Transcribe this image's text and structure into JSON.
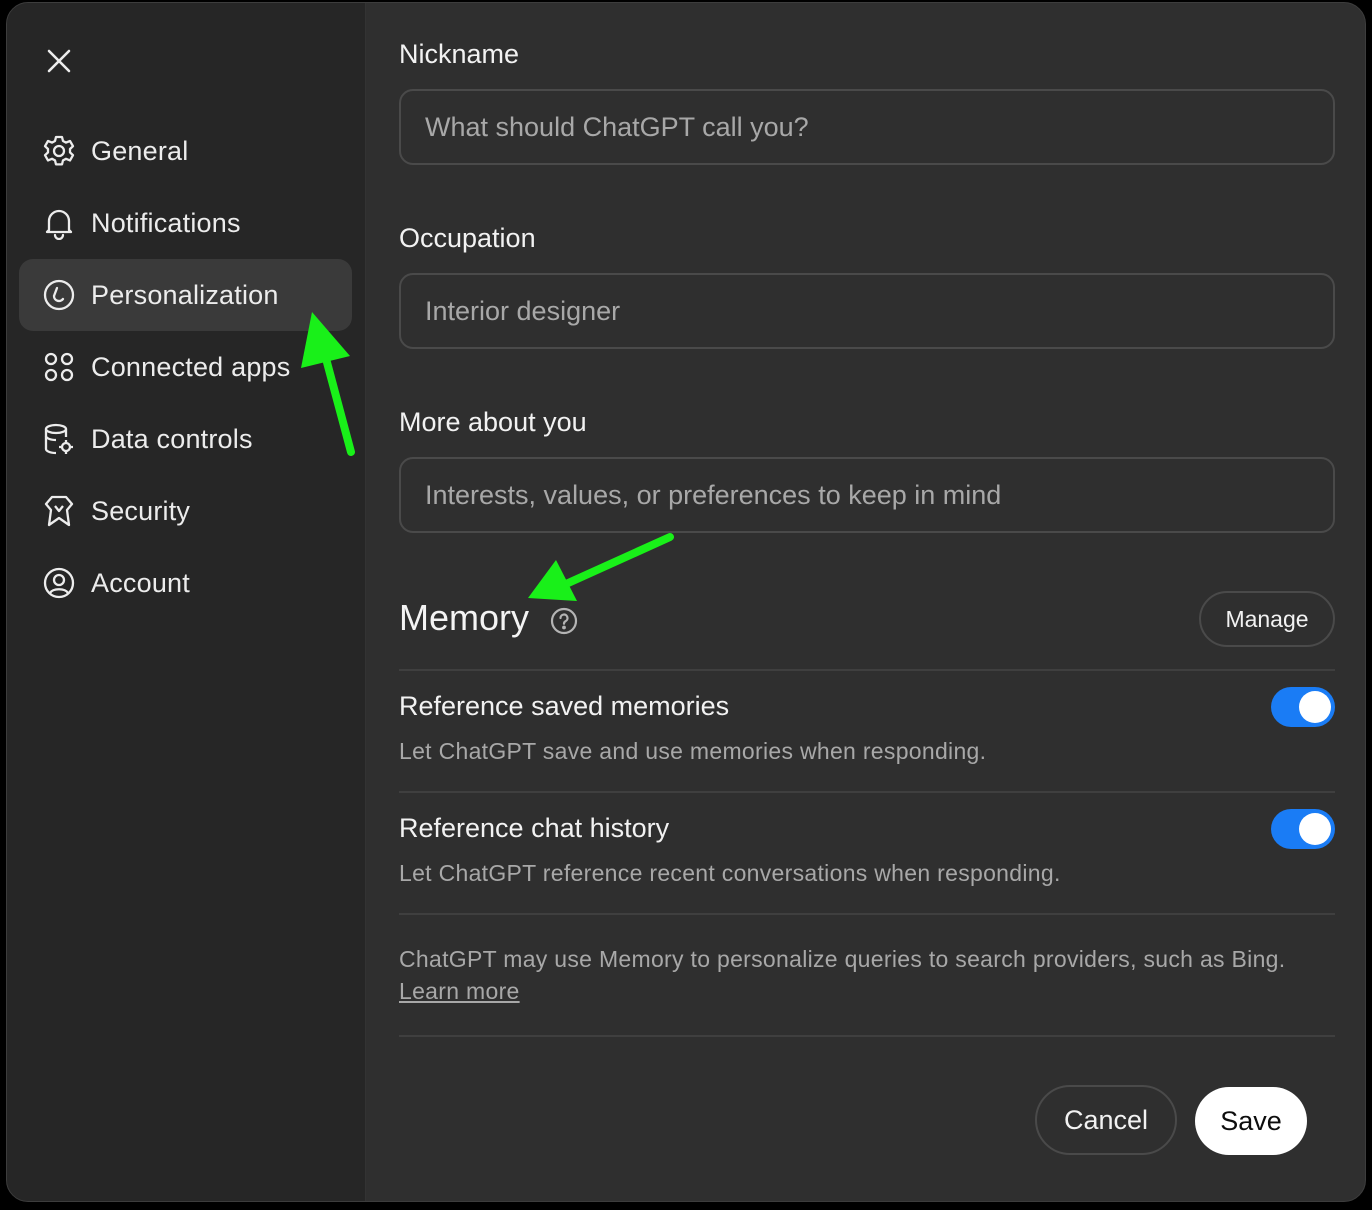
{
  "sidebar": {
    "close_icon": "close-icon",
    "items": [
      {
        "label": "General",
        "icon": "gear-icon"
      },
      {
        "label": "Notifications",
        "icon": "bell-icon"
      },
      {
        "label": "Personalization",
        "icon": "personalization-icon",
        "active": true
      },
      {
        "label": "Connected apps",
        "icon": "apps-icon"
      },
      {
        "label": "Data controls",
        "icon": "database-gear-icon"
      },
      {
        "label": "Security",
        "icon": "shield-icon"
      },
      {
        "label": "Account",
        "icon": "user-circle-icon"
      }
    ]
  },
  "form": {
    "nickname": {
      "label": "Nickname",
      "value": "",
      "placeholder": "What should ChatGPT call you?"
    },
    "occupation": {
      "label": "Occupation",
      "value": "",
      "placeholder": "Interior designer"
    },
    "more_about": {
      "label": "More about you",
      "value": "",
      "placeholder": "Interests, values, or preferences to keep in mind"
    }
  },
  "memory": {
    "title": "Memory",
    "help_icon": "help-circle-icon",
    "manage_label": "Manage",
    "settings": [
      {
        "title": "Reference saved memories",
        "description": "Let ChatGPT save and use memories when responding.",
        "enabled": true
      },
      {
        "title": "Reference chat history",
        "description": "Let ChatGPT reference recent conversations when responding.",
        "enabled": true
      }
    ],
    "footnote": "ChatGPT may use Memory to personalize queries to search providers, such as Bing.",
    "learn_more": "Learn more"
  },
  "actions": {
    "cancel_label": "Cancel",
    "save_label": "Save"
  },
  "colors": {
    "background": "#2f2f2f",
    "sidebar": "#262626",
    "toggle_on": "#1a7cf5",
    "annotation_arrow": "#19f019"
  }
}
